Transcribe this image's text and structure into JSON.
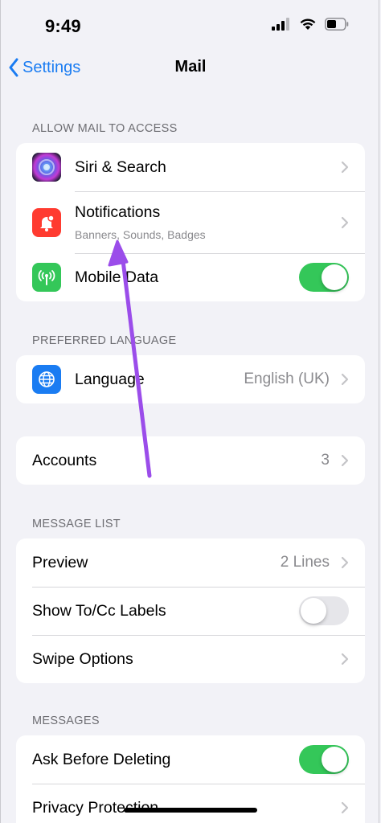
{
  "status_bar": {
    "time": "9:49"
  },
  "nav": {
    "back_label": "Settings",
    "title": "Mail"
  },
  "sections": {
    "allow_access": {
      "header": "ALLOW MAIL TO ACCESS",
      "siri_label": "Siri & Search",
      "notifications_label": "Notifications",
      "notifications_sub": "Banners, Sounds, Badges",
      "mobile_data_label": "Mobile Data",
      "mobile_data_on": true
    },
    "preferred_language": {
      "header": "PREFERRED LANGUAGE",
      "language_label": "Language",
      "language_value": "English (UK)"
    },
    "accounts": {
      "label": "Accounts",
      "value": "3"
    },
    "message_list": {
      "header": "MESSAGE LIST",
      "preview_label": "Preview",
      "preview_value": "2 Lines",
      "show_tocc_label": "Show To/Cc Labels",
      "show_tocc_on": false,
      "swipe_label": "Swipe Options"
    },
    "messages": {
      "header": "MESSAGES",
      "ask_delete_label": "Ask Before Deleting",
      "ask_delete_on": true,
      "privacy_label": "Privacy Protection"
    }
  },
  "colors": {
    "accent": "#1a7cf2",
    "toggle_on": "#34c759",
    "annotation_arrow": "#9b4dea"
  }
}
